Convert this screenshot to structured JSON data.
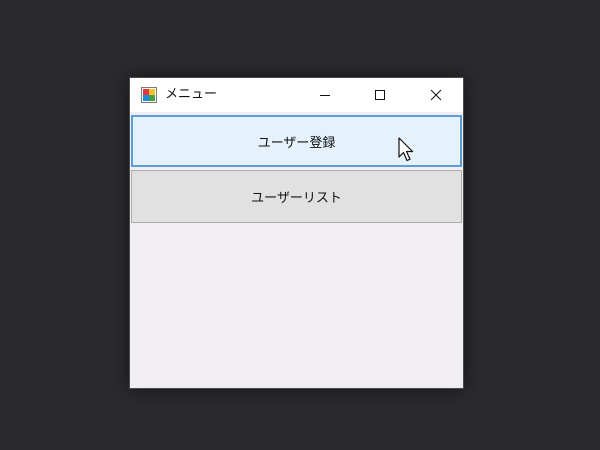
{
  "window": {
    "title": "メニュー",
    "controls": {
      "minimize_icon": "minimize-icon",
      "maximize_icon": "maximize-icon",
      "close_icon": "close-icon"
    }
  },
  "buttons": {
    "user_register": "ユーザー登録",
    "user_list": "ユーザーリスト"
  },
  "colors": {
    "desktop_background": "#2b2b2e",
    "titlebar": "#ffffff",
    "client_area": "#f0eef0",
    "hover_button_fill": "#e5f1fb",
    "hover_button_border": "#5a9fd6",
    "button_fill": "#e1e1e1",
    "button_border": "#adadad"
  }
}
